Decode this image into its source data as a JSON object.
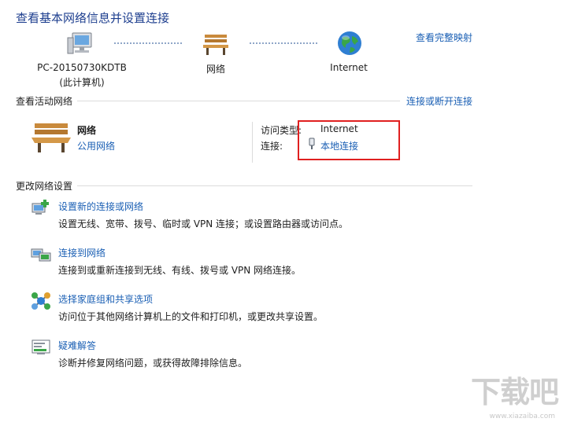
{
  "header": {
    "title": "查看基本网络信息并设置连接",
    "full_map_link": "查看完整映射"
  },
  "map": {
    "computer": {
      "name": "PC-20150730KDTB",
      "sub": "(此计算机)"
    },
    "network": {
      "name": "网络"
    },
    "internet": {
      "name": "Internet"
    }
  },
  "active": {
    "section_title": "查看活动网络",
    "toggle_link": "连接或断开连接",
    "network_name": "网络",
    "network_type": "公用网络",
    "access_type_label": "访问类型:",
    "access_type_value": "Internet",
    "connection_label": "连接:",
    "connection_value": "本地连接"
  },
  "settings": {
    "section_title": "更改网络设置",
    "tasks": [
      {
        "link": "设置新的连接或网络",
        "desc": "设置无线、宽带、拨号、临时或 VPN 连接；或设置路由器或访问点。"
      },
      {
        "link": "连接到网络",
        "desc": "连接到或重新连接到无线、有线、拨号或 VPN 网络连接。"
      },
      {
        "link": "选择家庭组和共享选项",
        "desc": "访问位于其他网络计算机上的文件和打印机，或更改共享设置。"
      },
      {
        "link": "疑难解答",
        "desc": "诊断并修复网络问题，或获得故障排除信息。"
      }
    ]
  },
  "watermark": {
    "main": "下载吧",
    "sub": "www.xiazaiba.com"
  }
}
